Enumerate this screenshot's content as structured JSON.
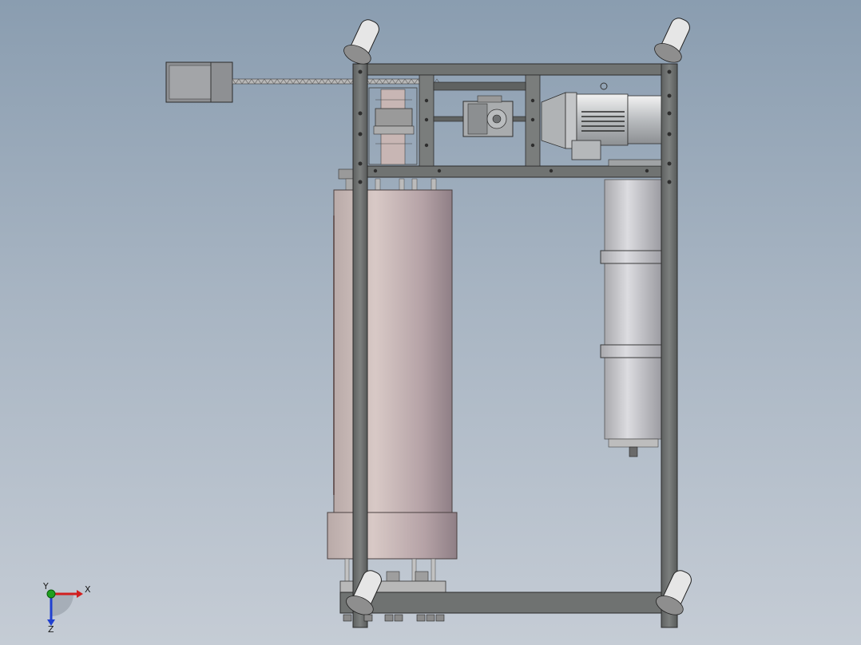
{
  "viewport": {
    "background_top": "#8a9db0",
    "background_bottom": "#c5ccd5"
  },
  "triad": {
    "x_label": "X",
    "y_label": "Y",
    "z_label": "Z",
    "x_color": "#d11f1f",
    "y_color": "#1fa01f",
    "z_color": "#2040d0"
  },
  "model": {
    "frame_color": "#6f7271",
    "cylinder_color": "#c9b8b6",
    "tank_color": "#c8c8cc",
    "motor_color": "#d8dadc",
    "caster_wheel_color": "#e4e4e4"
  }
}
